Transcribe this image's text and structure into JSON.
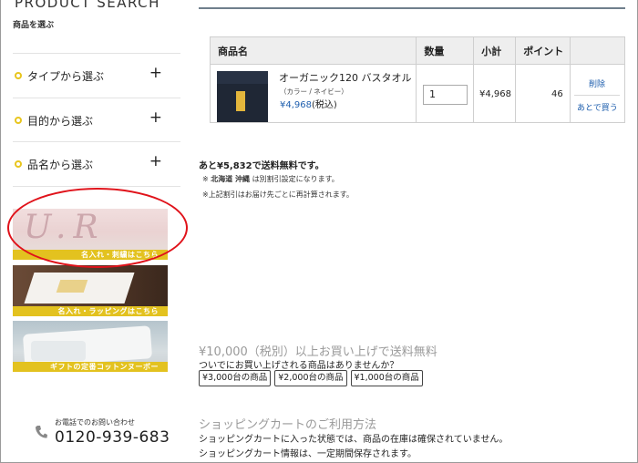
{
  "sidebar": {
    "title": "PRODUCT SEARCH",
    "subtitle": "商品を選ぶ",
    "items": [
      {
        "label": "タイプから選ぶ"
      },
      {
        "label": "目的から選ぶ"
      },
      {
        "label": "品名から選ぶ"
      }
    ],
    "plus_icon": "+",
    "banners": [
      {
        "caption": "名入れ・刺繍はこちら",
        "embroidery": "U.R"
      },
      {
        "caption": "名入れ・ラッピングはこちら"
      },
      {
        "caption": "ギフトの定番コットンヌーボー"
      }
    ],
    "contact": {
      "label": "お電話でのお問い合わせ",
      "number": "0120-939-683",
      "icon": "phone-icon"
    }
  },
  "cart": {
    "headers": {
      "name": "商品名",
      "qty": "数量",
      "subtotal": "小計",
      "points": "ポイント"
    },
    "item": {
      "name": "オーガニック120 バスタオル",
      "variant": "（カラー / ネイビー）",
      "price": "¥4,968",
      "tax": "(税込)",
      "qty": "1",
      "subtotal": "¥4,968",
      "points": "46",
      "delete_label": "削除",
      "later_label": "あとで買う"
    }
  },
  "shipping": {
    "remaining": "あと¥5,832で送料無料です。",
    "note1_prefix": "※ ",
    "note1_regions": "北海道 沖縄",
    "note1_suffix": " は別割引設定になります。",
    "note2": "※上記割引はお届け先ごとに再計算されます。"
  },
  "promo": {
    "heading": "¥10,000（税別）以上お買い上げで送料無料",
    "sub": "ついでにお買い上げされる商品はありませんか？",
    "chips": [
      "¥3,000台の商品",
      "¥2,000台の商品",
      "¥1,000台の商品"
    ]
  },
  "guide": {
    "heading": "ショッピングカートのご利用方法",
    "line1": "ショッピングカートに入った状態では、商品の在庫は確保されていません。",
    "line2": "ショッピングカート情報は、一定期間保存されます。"
  },
  "colors": {
    "accent_yellow": "#e8c51e",
    "link_blue": "#1f5fae",
    "highlight_red": "#e0121a"
  }
}
